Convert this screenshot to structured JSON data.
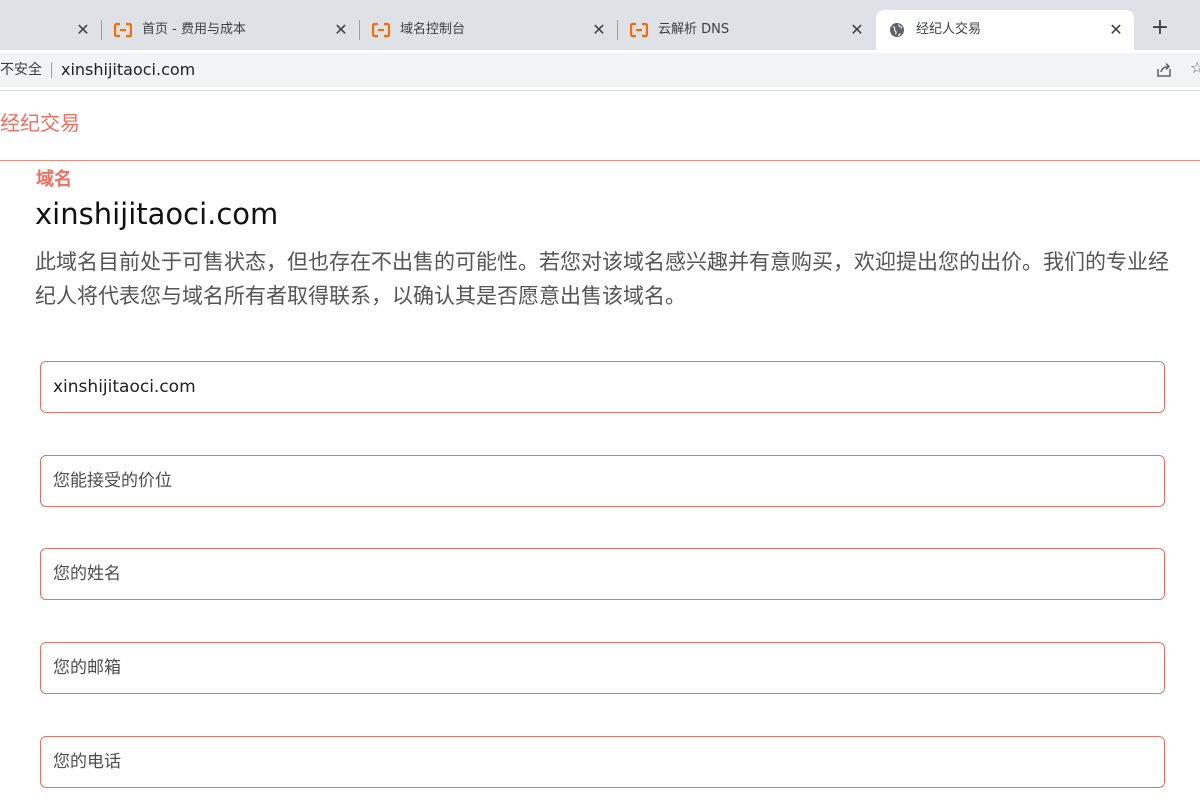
{
  "browser": {
    "tabs": [
      {
        "title": "",
        "icon": "blank"
      },
      {
        "title": "首页 - 费用与成本",
        "icon": "aliyun-logo-icon"
      },
      {
        "title": "域名控制台",
        "icon": "aliyun-logo-icon"
      },
      {
        "title": "云解析 DNS",
        "icon": "aliyun-logo-icon"
      },
      {
        "title": "经纪人交易",
        "icon": "globe-icon",
        "active": true
      }
    ],
    "close_glyph": "✕",
    "new_tab_glyph": "+",
    "security_label": "不安全",
    "url": "xinshijitaoci.com",
    "accent_color": "#ff6a00"
  },
  "page": {
    "logo_text": "经纪交易",
    "section_label": "域名",
    "domain": "xinshijitaoci.com",
    "description": "此域名目前处于可售状态，但也存在不出售的可能性。若您对该域名感兴趣并有意购买，欢迎提出您的出价。我们的专业经纪人将代表您与域名所有者取得联系，以确认其是否愿意出售该域名。",
    "brand_color": "#f0705f",
    "form": {
      "domain_value": "xinshijitaoci.com",
      "price_placeholder": "您能接受的价位",
      "name_placeholder": "您的姓名",
      "email_placeholder": "您的邮箱",
      "phone_placeholder": "您的电话"
    }
  }
}
